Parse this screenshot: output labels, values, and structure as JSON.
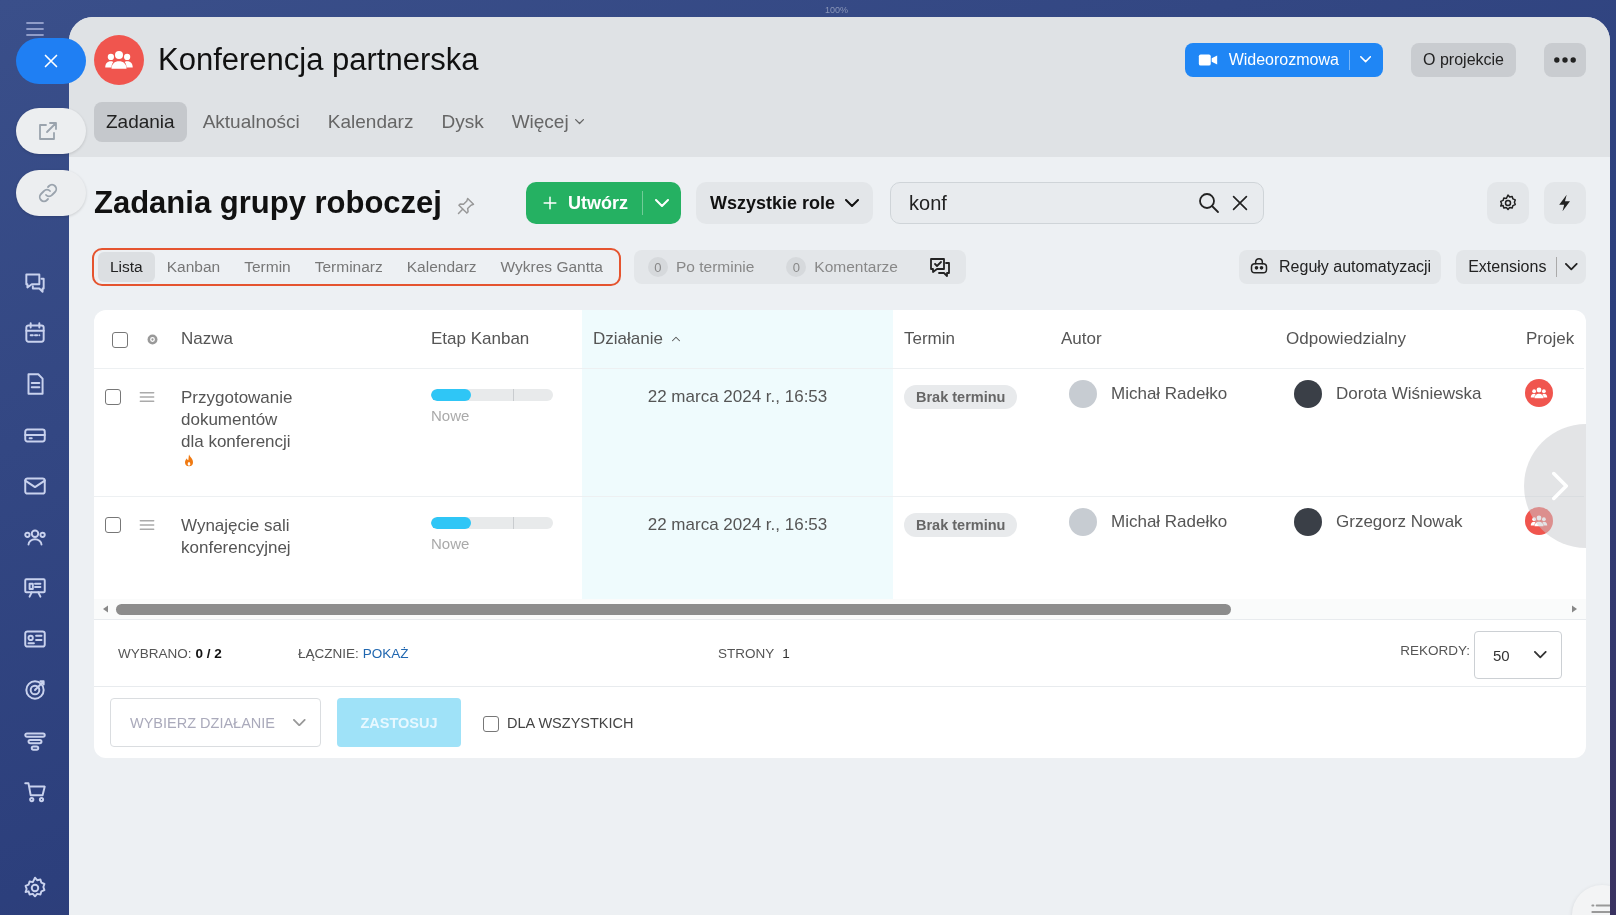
{
  "zoom_label": "100%",
  "header": {
    "title": "Konferencja partnerska",
    "video_button": "Wideorozmowa",
    "about_button": "O projekcie"
  },
  "nav_tabs": [
    {
      "label": "Zadania",
      "selected": true,
      "kind": "link"
    },
    {
      "label": "Aktualności",
      "selected": false,
      "kind": "link"
    },
    {
      "label": "Kalendarz",
      "selected": false,
      "kind": "link"
    },
    {
      "label": "Dysk",
      "selected": false,
      "kind": "link"
    },
    {
      "label": "Więcej",
      "selected": false,
      "kind": "menu"
    }
  ],
  "page_title": "Zadania grupy roboczej",
  "create_button": "Utwórz",
  "role_filter": "Wszystkie role",
  "search": {
    "value": "konf"
  },
  "view_tabs": [
    {
      "label": "Lista",
      "selected": true
    },
    {
      "label": "Kanban",
      "selected": false
    },
    {
      "label": "Termin",
      "selected": false
    },
    {
      "label": "Terminarz",
      "selected": false
    },
    {
      "label": "Kalendarz",
      "selected": false
    },
    {
      "label": "Wykres Gantta",
      "selected": false
    }
  ],
  "counters": [
    {
      "count": "0",
      "label": "Po terminie"
    },
    {
      "count": "0",
      "label": "Komentarze"
    }
  ],
  "automation_button": "Reguły automatyzacji",
  "extensions_button": "Extensions",
  "table": {
    "all_checked": false,
    "columns": [
      {
        "label": "Nazwa",
        "sorted": false
      },
      {
        "label": "Etap Kanban",
        "sorted": false
      },
      {
        "label": "Działanie",
        "sorted": true
      },
      {
        "label": "Termin",
        "sorted": false
      },
      {
        "label": "Autor",
        "sorted": false
      },
      {
        "label": "Odpowiedzialny",
        "sorted": false
      },
      {
        "label": "Projek",
        "sorted": false
      }
    ],
    "rows": [
      {
        "checked": false,
        "name": "Przygotowanie dokumentów dla konferencji",
        "hot": true,
        "stage": "Nowe",
        "level": 0.33,
        "activity": "22 marca 2024 r., 16:53",
        "deadline": "Brak terminu",
        "author": "Michał Radełko",
        "responsible": "Dorota Wiśniewska"
      },
      {
        "checked": false,
        "name": "Wynajęcie sali konferencyjnej",
        "hot": false,
        "stage": "Nowe",
        "level": 0.33,
        "activity": "22 marca 2024 r., 16:53",
        "deadline": "Brak terminu",
        "author": "Michał Radełko",
        "responsible": "Grzegorz Nowak"
      }
    ]
  },
  "footer": {
    "selected_label": "WYBRANO:",
    "selected_value": "0 / 2",
    "total_label": "ŁĄCZNIE:",
    "total_link": "POKAŻ",
    "pages_label": "STRONY",
    "pages_value": "1",
    "records_label": "REKORDY:",
    "records_value": "50"
  },
  "actions": {
    "action_placeholder": "WYBIERZ DZIAŁANIE",
    "apply_button": "ZASTOSUJ",
    "apply_disabled": true,
    "for_all": {
      "label": "DLA WSZYSTKICH",
      "checked": false
    }
  }
}
